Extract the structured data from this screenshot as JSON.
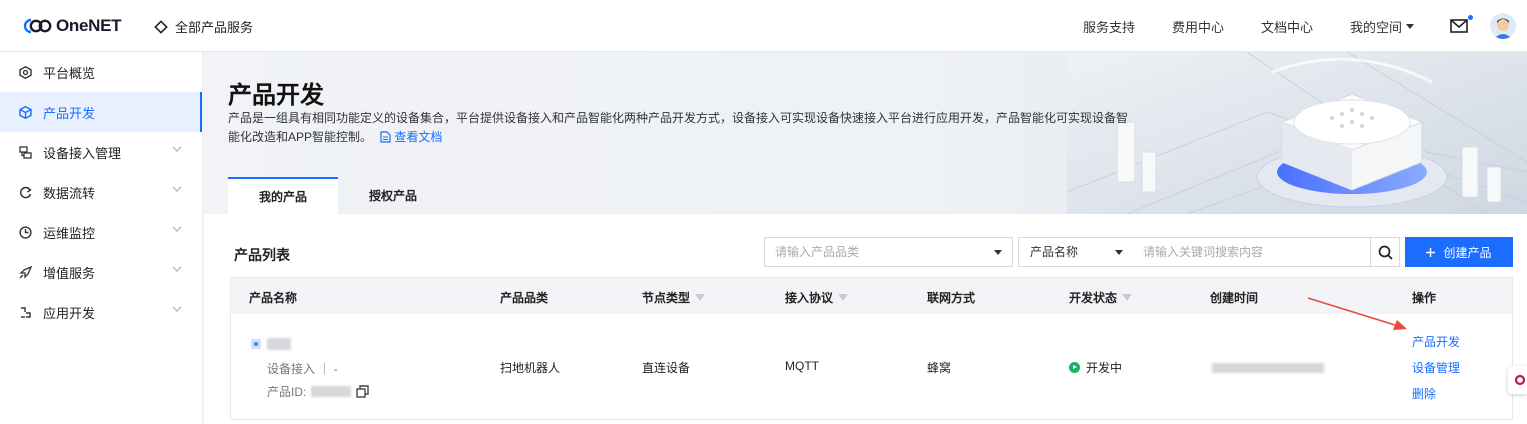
{
  "brand": {
    "logo_text": "OneNET",
    "all_services": "全部产品服务"
  },
  "topnav": {
    "items": [
      "服务支持",
      "费用中心",
      "文档中心"
    ],
    "my_space": "我的空间"
  },
  "sidebar": {
    "items": [
      {
        "label": "平台概览",
        "icon": "overview-icon",
        "expandable": false
      },
      {
        "label": "产品开发",
        "icon": "cube-icon",
        "expandable": false,
        "active": true
      },
      {
        "label": "设备接入管理",
        "icon": "device-icon",
        "expandable": true
      },
      {
        "label": "数据流转",
        "icon": "flow-icon",
        "expandable": true
      },
      {
        "label": "运维监控",
        "icon": "monitor-icon",
        "expandable": true
      },
      {
        "label": "增值服务",
        "icon": "rocket-icon",
        "expandable": true
      },
      {
        "label": "应用开发",
        "icon": "app-icon",
        "expandable": true
      }
    ]
  },
  "page": {
    "title": "产品开发",
    "description": "产品是一组具有相同功能定义的设备集合，平台提供设备接入和产品智能化两种产品开发方式，设备接入可实现设备快速接入平台进行应用开发，产品智能化可实现设备智能化改造和APP智能控制。",
    "doc_link": "查看文档",
    "tabs": [
      "我的产品",
      "授权产品"
    ]
  },
  "list": {
    "title": "产品列表",
    "category_placeholder": "请输入产品品类",
    "field_select": "产品名称",
    "keyword_placeholder": "请输入关键词搜索内容",
    "create_button": "创建产品"
  },
  "table": {
    "headers": [
      "产品名称",
      "产品品类",
      "节点类型",
      "接入协议",
      "联网方式",
      "开发状态",
      "创建时间",
      "操作"
    ],
    "rows": [
      {
        "access_type": "设备接入 ｜ -",
        "id_label": "产品ID:",
        "category": "扫地机器人",
        "node_type": "直连设备",
        "protocol": "MQTT",
        "network": "蜂窝",
        "status": "开发中",
        "actions": [
          "产品开发",
          "设备管理",
          "删除"
        ]
      }
    ]
  },
  "colors": {
    "accent": "#1a6dff",
    "status_green": "#17b26a",
    "arrow_red": "#e74c3c"
  }
}
